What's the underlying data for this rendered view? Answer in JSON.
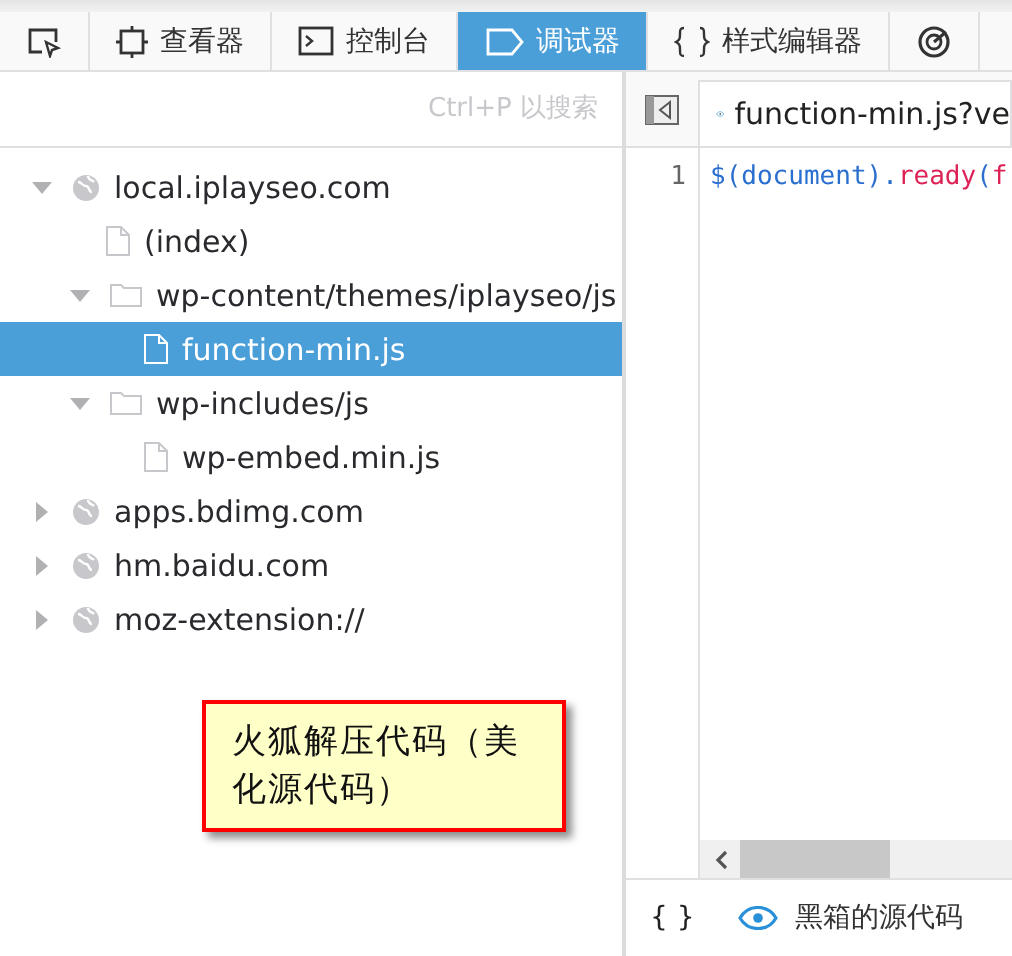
{
  "toolbar": {
    "tabs": [
      {
        "kind": "picker",
        "selected": false
      },
      {
        "kind": "inspector",
        "label": "查看器",
        "selected": false
      },
      {
        "kind": "console",
        "label": "控制台",
        "selected": false
      },
      {
        "kind": "debugger",
        "label": "调试器",
        "selected": true
      },
      {
        "kind": "style",
        "label": "样式编辑器",
        "selected": false
      },
      {
        "kind": "performance",
        "selected": false
      }
    ]
  },
  "sources": {
    "search": {
      "placeholder": "Ctrl+P 以搜索"
    },
    "tree": [
      {
        "kind": "domain",
        "label": "local.iplayseo.com",
        "expanded": true,
        "selected": false,
        "children": [
          {
            "kind": "file",
            "label": "(index)",
            "selected": false
          },
          {
            "kind": "folder",
            "label": "wp-content/themes/iplayseo/js",
            "expanded": true,
            "selected": false,
            "children": [
              {
                "kind": "file",
                "label": "function-min.js",
                "selected": true
              }
            ]
          },
          {
            "kind": "folder",
            "label": "wp-includes/js",
            "expanded": true,
            "selected": false,
            "children": [
              {
                "kind": "file",
                "label": "wp-embed.min.js",
                "selected": false
              }
            ]
          }
        ]
      },
      {
        "kind": "domain",
        "label": "apps.bdimg.com",
        "expanded": false,
        "selected": false
      },
      {
        "kind": "domain",
        "label": "hm.baidu.com",
        "expanded": false,
        "selected": false
      },
      {
        "kind": "domain",
        "label": "moz-extension://",
        "expanded": false,
        "selected": false
      }
    ]
  },
  "editor": {
    "tab": {
      "label": "function-min.js?ve"
    },
    "lines": [
      {
        "number": "1",
        "tokens": [
          {
            "kind": "punct",
            "text": "$("
          },
          {
            "kind": "name",
            "text": "document"
          },
          {
            "kind": "punct",
            "text": ")."
          },
          {
            "kind": "method",
            "text": "ready"
          },
          {
            "kind": "punct",
            "text": "("
          },
          {
            "kind": "method",
            "text": "f"
          }
        ]
      }
    ],
    "footer": {
      "pretty_print": "{ }",
      "blackbox": "黑箱的源代码"
    }
  },
  "annotation": {
    "text": "火狐解压代码（美化源代码）"
  }
}
